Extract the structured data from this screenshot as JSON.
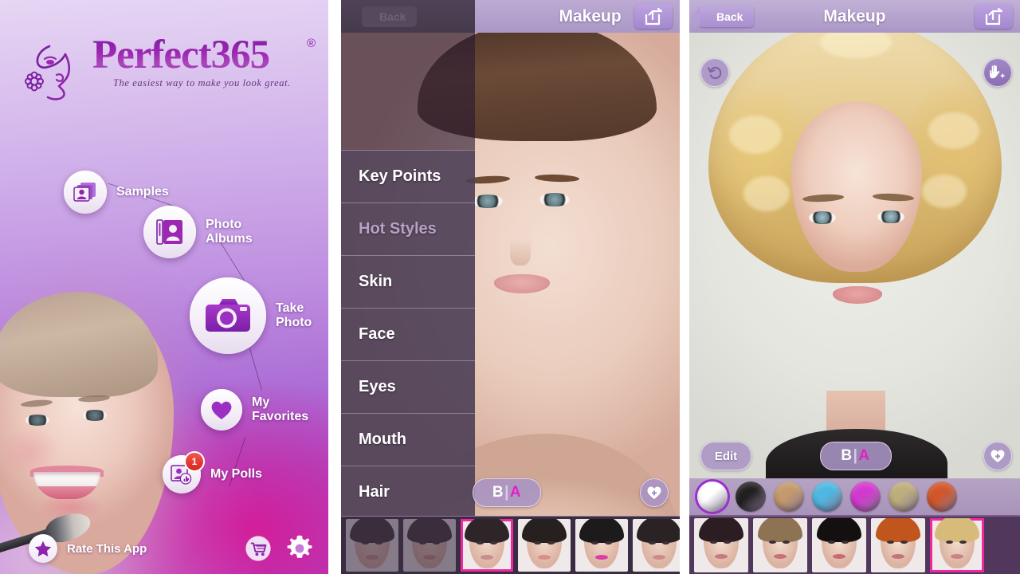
{
  "app": {
    "name": "Perfect365",
    "logo_mark": "Perfect365",
    "registered_mark": "®",
    "tagline": "The easiest way to make you look great."
  },
  "home": {
    "menu": [
      {
        "label": "Samples",
        "icon": "photo-stack-icon",
        "badge": null
      },
      {
        "label": "Photo\nAlbums",
        "icon": "photo-album-icon",
        "badge": null
      },
      {
        "label": "Take\nPhoto",
        "icon": "camera-icon",
        "badge": null
      },
      {
        "label": "My\nFavorites",
        "icon": "heart-icon",
        "badge": null
      },
      {
        "label": "My Polls",
        "icon": "poll-icon",
        "badge": "1"
      }
    ],
    "rate_label": "Rate This App",
    "rate_icon": "star-icon",
    "store_icon": "shopping-cart-icon",
    "settings_icon": "gear-icon"
  },
  "makeup": {
    "header": {
      "back_label": "Back",
      "title": "Makeup",
      "share_icon": "share-icon"
    },
    "menu": [
      {
        "label": "Key Points",
        "state": "normal"
      },
      {
        "label": "Hot Styles",
        "state": "dim"
      },
      {
        "label": "Skin",
        "state": "normal"
      },
      {
        "label": "Face",
        "state": "normal"
      },
      {
        "label": "Eyes",
        "state": "normal"
      },
      {
        "label": "Mouth",
        "state": "normal"
      },
      {
        "label": "Hair",
        "state": "normal"
      }
    ],
    "compare": {
      "before": "B",
      "separator": "|",
      "after": "A"
    },
    "favorite_icon": "heart-plus-icon",
    "styles": [
      {
        "name": "style-1",
        "selected": false,
        "faded": true,
        "hair": "#3a2f34",
        "lip": "#c98b8c",
        "skin": "#e9cdbf"
      },
      {
        "name": "style-2",
        "selected": false,
        "faded": true,
        "hair": "#3a2f34",
        "lip": "#c98b8c",
        "skin": "#e9cdbf"
      },
      {
        "name": "style-3",
        "selected": true,
        "faded": false,
        "hair": "#2e2529",
        "lip": "#c98c8f",
        "skin": "#f0d7c8"
      },
      {
        "name": "style-4",
        "selected": false,
        "faded": false,
        "hair": "#26201f",
        "lip": "#d98f86",
        "skin": "#f1d8c9"
      },
      {
        "name": "style-5",
        "selected": false,
        "faded": false,
        "hair": "#1d1a1c",
        "lip": "#d83fa8",
        "skin": "#f1d8c9"
      },
      {
        "name": "style-6",
        "selected": false,
        "faded": false,
        "hair": "#2b2224",
        "lip": "#cf8b8b",
        "skin": "#eed5c6"
      }
    ]
  },
  "hair": {
    "header": {
      "back_label": "Back",
      "title": "Makeup",
      "share_icon": "share-icon"
    },
    "undo_icon": "undo-icon",
    "touch_icon": "hand-touch-icon",
    "edit_label": "Edit",
    "compare": {
      "before": "B",
      "separator": "|",
      "after": "A"
    },
    "favorite_icon": "heart-plus-icon",
    "colors": [
      {
        "name": "white",
        "hex": "#ffffff",
        "selected": true
      },
      {
        "name": "black",
        "hex": "#221f20",
        "selected": false
      },
      {
        "name": "light-brown",
        "hex": "#c49a6c",
        "selected": false
      },
      {
        "name": "sky-blue",
        "hex": "#4db8e2",
        "selected": false
      },
      {
        "name": "magenta",
        "hex": "#d338cf",
        "selected": false
      },
      {
        "name": "khaki",
        "hex": "#bdae7c",
        "selected": false
      },
      {
        "name": "burnt-orange",
        "hex": "#d2562a",
        "selected": false
      }
    ],
    "styles": [
      {
        "name": "hair-1",
        "selected": false,
        "hair": "#2b1d22",
        "lip": "#c8797f"
      },
      {
        "name": "hair-2",
        "selected": false,
        "hair": "#8d7354",
        "lip": "#c9707b"
      },
      {
        "name": "hair-3",
        "selected": false,
        "hair": "#14100f",
        "lip": "#c96a74"
      },
      {
        "name": "hair-4",
        "selected": false,
        "hair": "#c0551e",
        "lip": "#c4737b"
      },
      {
        "name": "hair-5",
        "selected": true,
        "hair": "#d7bb7a",
        "lip": "#cf7f87"
      }
    ]
  },
  "theme": {
    "brand_purple": "#8e24aa",
    "accent_magenta": "#e220c8",
    "selection_pink": "#ef27a0",
    "header_lavender": "#b6a5d0",
    "sidebar_plum": "#5d4f63"
  }
}
